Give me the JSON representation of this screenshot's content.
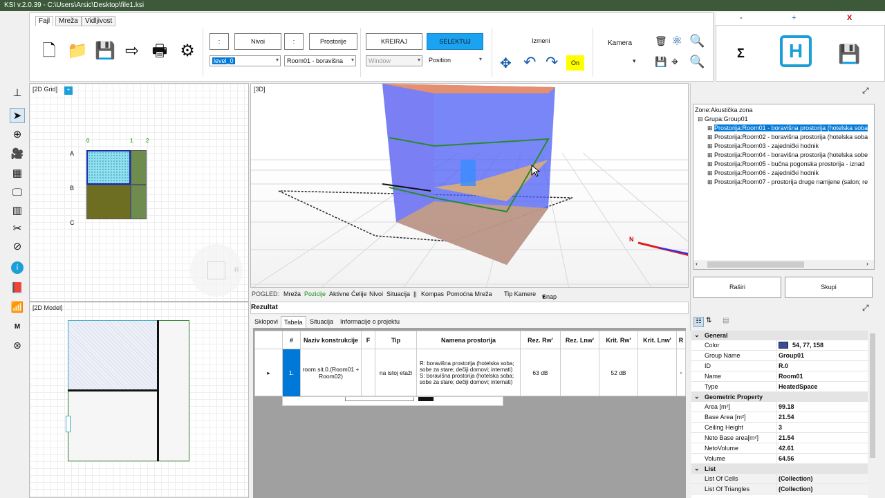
{
  "title": "KSI v.2.0.39 - C:\\Users\\Arsic\\Desktop\\file1.ksi",
  "menu_tabs": [
    "Fajl",
    "Mreža",
    "Vidljivost"
  ],
  "ribbon": {
    "colon1": ":",
    "nivoi_label": "Nivoi",
    "colon2": ":",
    "prostorije_label": "Prostorije",
    "level_value": "level_0",
    "room_value": "Room01 - boravišna",
    "kreiraj": "KREIRAJ",
    "selektuj": "SELEKTUJ",
    "window_value": "Window",
    "position_value": "Position",
    "izmeni_label": "Izmeni",
    "on_label": "On",
    "kamera_label": "Kamera"
  },
  "window_controls": {
    "minimize": "-",
    "restore": "+",
    "close": "X"
  },
  "right_top": {
    "sigma": "Σ"
  },
  "panels": {
    "grid2d": "[2D Grid]",
    "model2d": "[2D Model]",
    "view3d": "[3D]",
    "grid_cols": [
      "0",
      "1",
      "2"
    ],
    "grid_rows": [
      "A",
      "B",
      "C"
    ],
    "compass_letter": "R",
    "north_label": "N"
  },
  "view_bar": {
    "pogled": "POGLED:",
    "items": [
      "Mreža",
      "Pozicije",
      "Aktivne Ćelije",
      "Nivoi",
      "Situacija",
      "||",
      "Kompas",
      "Pomoćna Mreža"
    ],
    "tip_kamere": "Tip Kamere",
    "snap": "Snap"
  },
  "rezultat": {
    "title": "Rezultat",
    "tabs": [
      "Sklopovi",
      "Tabela",
      "Situacija",
      "Informacije o projektu"
    ],
    "headers": [
      "#",
      "Naziv konstrukcije",
      "F",
      "Tip",
      "Namena prostorija",
      "Rez. Rw'",
      "Rez. Lnw'",
      "Krit. Rw'",
      "Krit. Lnw'",
      "R"
    ],
    "row": {
      "num": "1.",
      "naziv": "room sit.0.(Room01 + Room02)",
      "f": "",
      "tip": "na istoj etaži",
      "namena": "R: boravišna prostorija (hotelska soba; sobe za stare; dečiji domovi; internati)\nS: boravišna prostorija (hotelska soba; sobe za stare; dečiji domovi; internati)",
      "rez_rw": "63 dB",
      "rez_lnw": "",
      "krit_rw": "52 dB",
      "krit_lnw": ""
    }
  },
  "tree": {
    "zone": "Zone:Akustička zona",
    "group": "Grupa:Group01",
    "rooms": [
      "Prostorija:Room01 - boravišna prostorija (hotelska soba",
      "Prostorija:Room02 - boravišna prostorija (hotelska soba",
      "Prostorija:Room03 - zajednički hodnik",
      "Prostorija:Room04 - boravišna prostorija (hotelska sobe",
      "Prostorija:Room05 - bučna pogonska prostorija - iznad",
      "Prostorija:Room06 - zajednički hodnik",
      "Prostorija:Room07 - prostorija druge namjene (salon; re"
    ],
    "btn_expand": "Raširi",
    "btn_collapse": "Skupi"
  },
  "properties": {
    "sections": [
      {
        "name": "General",
        "rows": [
          [
            "Color",
            "54, 77, 158"
          ],
          [
            "Group Name",
            "Group01"
          ],
          [
            "ID",
            "R.0"
          ],
          [
            "Name",
            "Room01"
          ],
          [
            "Type",
            "HeatedSpace"
          ]
        ]
      },
      {
        "name": "Geometric Property",
        "rows": [
          [
            "Area [m²]",
            "99.18"
          ],
          [
            "Base Area [m²]",
            "21.54"
          ],
          [
            "Ceiling Height",
            "3"
          ],
          [
            "Neto Base area[m²]",
            "21.54"
          ],
          [
            "NetoVolume",
            "42.61"
          ],
          [
            "Volume",
            "64.56"
          ]
        ]
      },
      {
        "name": "List",
        "rows": [
          [
            "List Of Cells",
            "(Collection)"
          ],
          [
            "List Of Triangles",
            "(Collection)"
          ]
        ]
      }
    ],
    "color_swatch": "#364d9e"
  },
  "left_toolbar_icons": [
    "axis-icon",
    "pointer-icon",
    "add-circle-icon",
    "camera-icon",
    "table-grid-icon",
    "monitor-icon",
    "panel-icon",
    "tools-icon",
    "compass-icon",
    "info-icon",
    "book-icon",
    "chart-icon",
    "M",
    "uk-flag-icon"
  ],
  "left_toolbar_m": "M"
}
